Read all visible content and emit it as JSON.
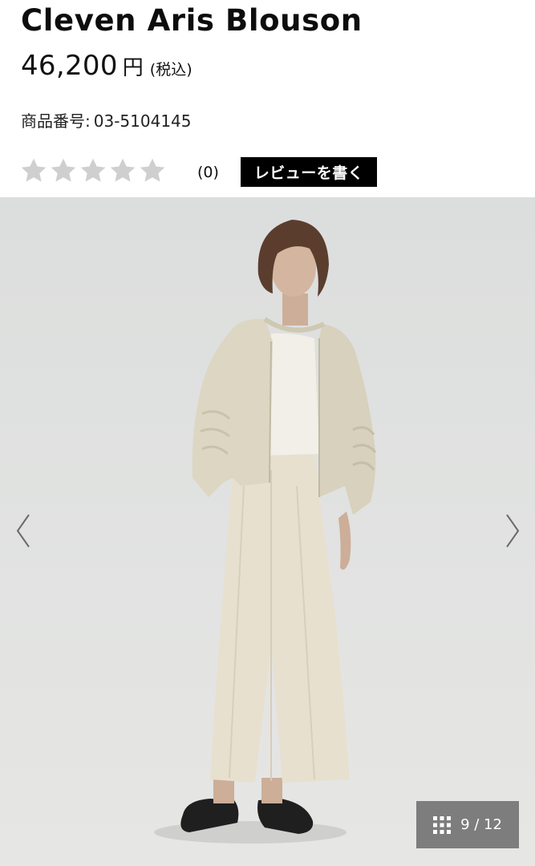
{
  "product": {
    "title": "Cleven Aris Blouson",
    "price": "46,200",
    "currency": "円",
    "tax_note": "(税込)",
    "sku_label": "商品番号:",
    "sku_value": "03-5104145"
  },
  "rating": {
    "stars_filled": 0,
    "stars_total": 5,
    "review_count": "(0)",
    "write_review_label": "レビューを書く",
    "star_color": "#cfcfcf"
  },
  "gallery": {
    "counter": "9 / 12",
    "current_index": 9,
    "total": 12,
    "prev_icon": "chevron-left-icon",
    "next_icon": "chevron-right-icon",
    "grid_icon": "grid-icon",
    "badge_color": "#6e6e6e"
  }
}
